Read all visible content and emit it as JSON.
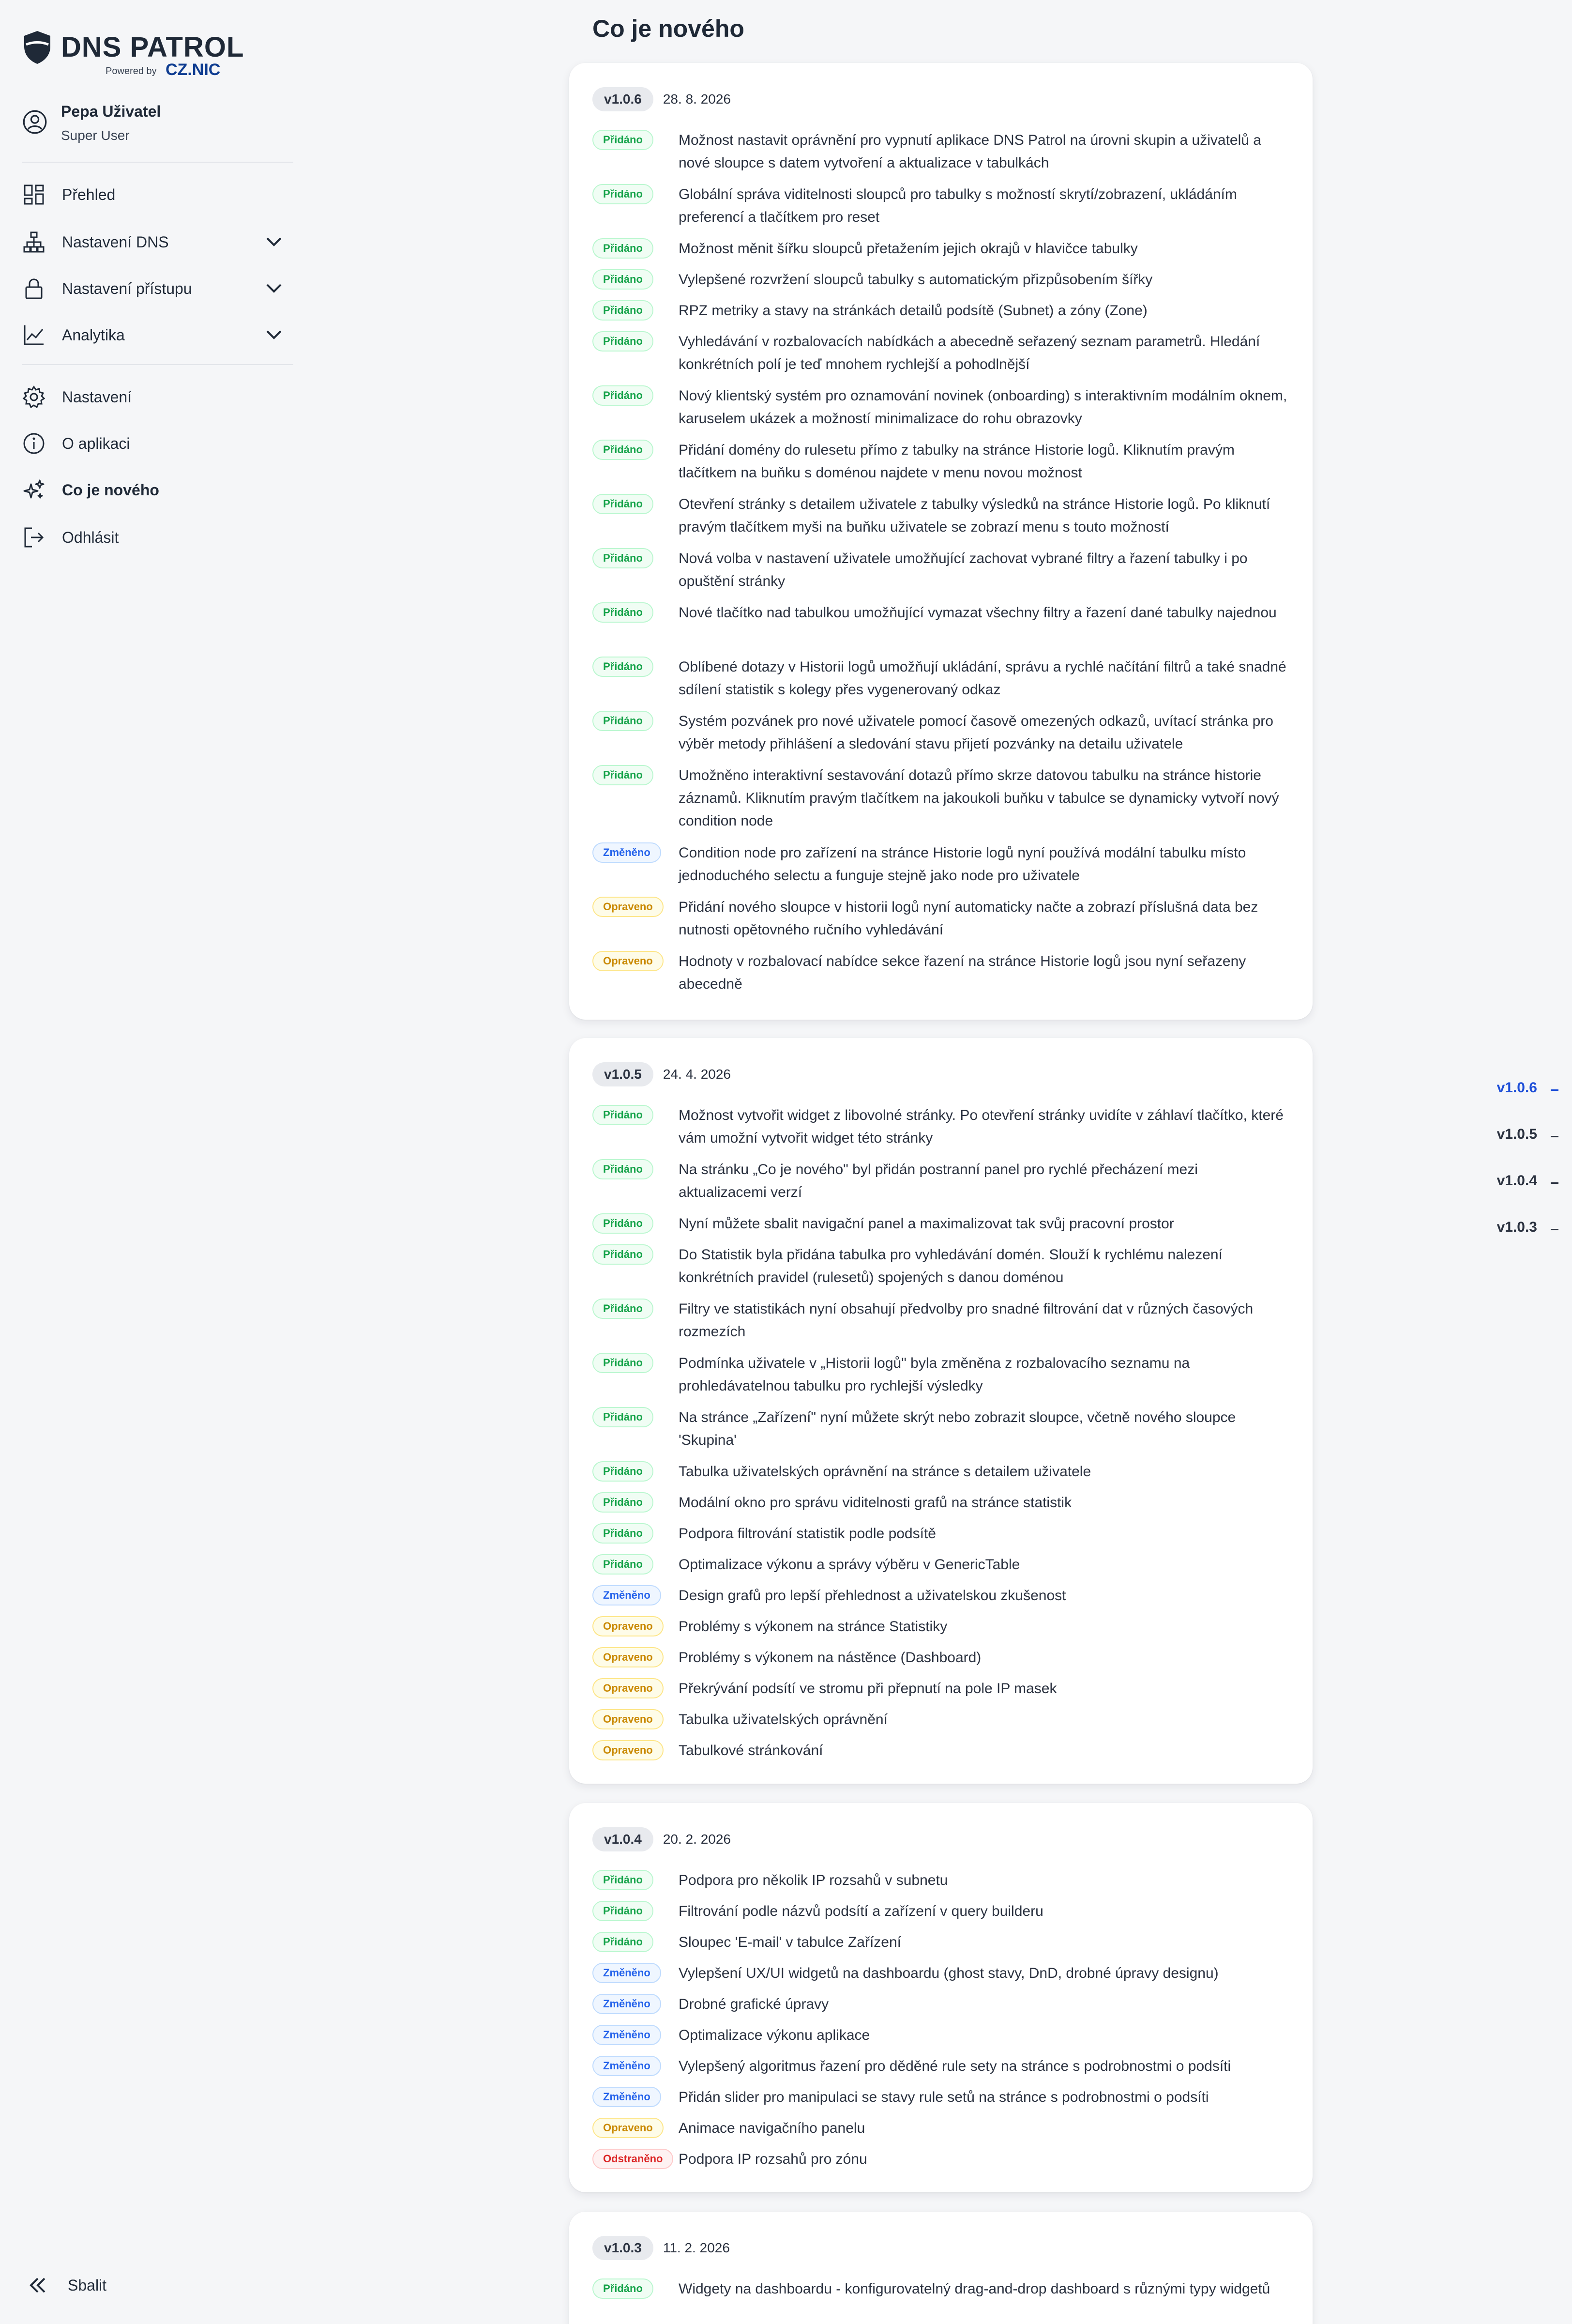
{
  "brand": {
    "title": "DNS PATROL",
    "powered_by": "Powered by",
    "partner": "CZ.NIC"
  },
  "user": {
    "name": "Pepa Uživatel",
    "role": "Super User"
  },
  "nav": {
    "overview": "Přehled",
    "dns_settings": "Nastavení DNS",
    "access_settings": "Nastavení přístupu",
    "analytics": "Analytika",
    "settings": "Nastavení",
    "about": "O aplikaci",
    "whats_new": "Co je nového",
    "logout": "Odhlásit",
    "collapse": "Sbalit"
  },
  "page": {
    "title": "Co je nového"
  },
  "labels": {
    "added": "Přidáno",
    "changed": "Změněno",
    "fixed": "Opraveno",
    "removed": "Odstraněno"
  },
  "releases": [
    {
      "version": "v1.0.6",
      "date": "28. 8. 2026",
      "entries": [
        {
          "type": "added",
          "text": "Možnost nastavit oprávnění pro vypnutí aplikace DNS Patrol na úrovni skupin a uživatelů a nové sloupce s datem vytvoření a aktualizace v tabulkách"
        },
        {
          "type": "added",
          "text": "Globální správa viditelnosti sloupců pro tabulky s možností skrytí/zobrazení, ukládáním preferencí a tlačítkem pro reset"
        },
        {
          "type": "added",
          "text": "Možnost měnit šířku sloupců přetažením jejich okrajů v hlavičce tabulky"
        },
        {
          "type": "added",
          "text": "Vylepšené rozvržení sloupců tabulky s automatickým přizpůsobením šířky"
        },
        {
          "type": "added",
          "text": "RPZ metriky a stavy na stránkách detailů podsítě (Subnet) a zóny (Zone)"
        },
        {
          "type": "added",
          "text": "Vyhledávání v rozbalovacích nabídkách a abecedně seřazený seznam parametrů. Hledání konkrétních polí je teď mnohem rychlejší a pohodlnější"
        },
        {
          "type": "added",
          "text": "Nový klientský systém pro oznamování novinek (onboarding) s interaktivním modálním oknem, karuselem ukázek a možností minimalizace do rohu obrazovky"
        },
        {
          "type": "added",
          "text": "Přidání domény do rulesetu přímo z tabulky na stránce Historie logů. Kliknutím pravým tlačítkem na buňku s doménou najdete v menu novou možnost"
        },
        {
          "type": "added",
          "text": "Otevření stránky s detailem uživatele z tabulky výsledků na stránce Historie logů. Po kliknutí pravým tlačítkem myši na buňku uživatele se zobrazí menu s touto možností"
        },
        {
          "type": "added",
          "text": "Nová volba v nastavení uživatele umožňující zachovat vybrané filtry a řazení tabulky i po opuštění stránky"
        },
        {
          "type": "added",
          "text": "Nové tlačítko nad tabulkou umožňující vymazat všechny filtry a řazení dané tabulky najednou"
        },
        {
          "type": "added",
          "text": "Oblíbené dotazy v Historii logů umožňují ukládání, správu a rychlé načítání filtrů a také snadné sdílení statistik s kolegy přes vygenerovaný odkaz"
        },
        {
          "type": "added",
          "text": "Systém pozvánek pro nové uživatele pomocí časově omezených odkazů, uvítací stránka pro výběr metody přihlášení a sledování stavu přijetí pozvánky na detailu uživatele"
        },
        {
          "type": "added",
          "text": "Umožněno interaktivní sestavování dotazů přímo skrze datovou tabulku na stránce historie záznamů. Kliknutím pravým tlačítkem na jakoukoli buňku v tabulce se dynamicky vytvoří nový condition node"
        },
        {
          "type": "changed",
          "text": "Condition node pro zařízení na stránce Historie logů nyní používá modální tabulku místo jednoduchého selectu a funguje stejně jako node pro uživatele"
        },
        {
          "type": "fixed",
          "text": "Přidání nového sloupce v historii logů nyní automaticky načte a zobrazí příslušná data bez nutnosti opětovného ručního vyhledávání"
        },
        {
          "type": "fixed",
          "text": "Hodnoty v rozbalovací nabídce sekce řazení na stránce Historie logů jsou nyní seřazeny abecedně"
        }
      ]
    },
    {
      "version": "v1.0.5",
      "date": "24. 4. 2026",
      "entries": [
        {
          "type": "added",
          "text": "Možnost vytvořit widget z libovolné stránky. Po otevření stránky uvidíte v záhlaví tlačítko, které vám umožní vytvořit widget této stránky"
        },
        {
          "type": "added",
          "text": "Na stránku „Co je nového\" byl přidán postranní panel pro rychlé přecházení mezi aktualizacemi verzí"
        },
        {
          "type": "added",
          "text": "Nyní můžete sbalit navigační panel a maximalizovat tak svůj pracovní prostor"
        },
        {
          "type": "added",
          "text": "Do Statistik byla přidána tabulka pro vyhledávání domén. Slouží k rychlému nalezení konkrétních pravidel (rulesetů) spojených s danou doménou"
        },
        {
          "type": "added",
          "text": "Filtry ve statistikách nyní obsahují předvolby pro snadné filtrování dat v různých časových rozmezích"
        },
        {
          "type": "added",
          "text": "Podmínka uživatele v „Historii logů\" byla změněna z rozbalovacího seznamu na prohledávatelnou tabulku pro rychlejší výsledky"
        },
        {
          "type": "added",
          "text": "Na stránce „Zařízení\" nyní můžete skrýt nebo zobrazit sloupce, včetně nového sloupce 'Skupina'"
        },
        {
          "type": "added",
          "text": "Tabulka uživatelských oprávnění na stránce s detailem uživatele"
        },
        {
          "type": "added",
          "text": "Modální okno pro správu viditelnosti grafů na stránce statistik"
        },
        {
          "type": "added",
          "text": "Podpora filtrování statistik podle podsítě"
        },
        {
          "type": "added",
          "text": "Optimalizace výkonu a správy výběru v GenericTable"
        },
        {
          "type": "changed",
          "text": "Design grafů pro lepší přehlednost a uživatelskou zkušenost"
        },
        {
          "type": "fixed",
          "text": "Problémy s výkonem na stránce Statistiky"
        },
        {
          "type": "fixed",
          "text": "Problémy s výkonem na nástěnce (Dashboard)"
        },
        {
          "type": "fixed",
          "text": "Překrývání podsítí ve stromu při přepnutí na pole IP masek"
        },
        {
          "type": "fixed",
          "text": "Tabulka uživatelských oprávnění"
        },
        {
          "type": "fixed",
          "text": "Tabulkové stránkování"
        }
      ]
    },
    {
      "version": "v1.0.4",
      "date": "20. 2. 2026",
      "entries": [
        {
          "type": "added",
          "text": "Podpora pro několik IP rozsahů v subnetu"
        },
        {
          "type": "added",
          "text": "Filtrování podle názvů podsítí a zařízení v query builderu"
        },
        {
          "type": "added",
          "text": "Sloupec 'E-mail' v tabulce Zařízení"
        },
        {
          "type": "changed",
          "text": "Vylepšení UX/UI widgetů na dashboardu (ghost stavy, DnD, drobné úpravy designu)"
        },
        {
          "type": "changed",
          "text": "Drobné grafické úpravy"
        },
        {
          "type": "changed",
          "text": "Optimalizace výkonu aplikace"
        },
        {
          "type": "changed",
          "text": "Vylepšený algoritmus řazení pro děděné rule sety na stránce s podrobnostmi o podsíti"
        },
        {
          "type": "changed",
          "text": "Přidán slider pro manipulaci se stavy rule setů na stránce s podrobnostmi o podsíti"
        },
        {
          "type": "fixed",
          "text": "Animace navigačního panelu"
        },
        {
          "type": "removed",
          "text": "Podpora IP rozsahů pro zónu"
        }
      ]
    },
    {
      "version": "v1.0.3",
      "date": "11. 2. 2026",
      "entries": [
        {
          "type": "added",
          "text": "Widgety na dashboardu - konfigurovatelný drag-and-drop dashboard s různými typy widgetů"
        }
      ]
    }
  ],
  "rail": {
    "items": [
      "v1.0.6",
      "v1.0.5",
      "v1.0.4",
      "v1.0.3"
    ],
    "active": "v1.0.6"
  },
  "icons": {
    "user": "user-circle-icon",
    "overview": "grid-icon",
    "dns": "network-icon",
    "access": "lock-icon",
    "analytics": "chart-line-icon",
    "settings": "gear-icon",
    "about": "info-icon",
    "whats_new": "sparkles-icon",
    "logout": "logout-icon",
    "collapse": "double-chevron-left-icon"
  },
  "colors": {
    "added": "#16a34a",
    "changed": "#2563eb",
    "fixed": "#ca8a04",
    "removed": "#dc2626",
    "rail_active": "#1d4ed8",
    "brand": "#0f3d91"
  }
}
